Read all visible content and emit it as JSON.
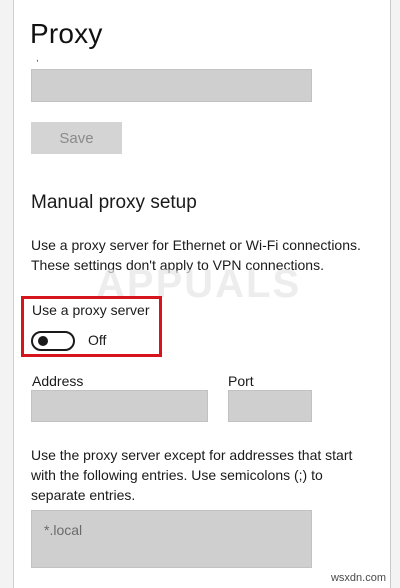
{
  "page": {
    "title": "Proxy"
  },
  "top_section": {
    "save_label": "Save"
  },
  "manual_proxy": {
    "heading": "Manual proxy setup",
    "description_line1": "Use a proxy server for Ethernet or Wi-Fi connections.",
    "description_line2": "These settings don't apply to VPN connections.",
    "use_proxy_label": "Use a proxy server",
    "toggle_state": "Off",
    "address_label": "Address",
    "address_value": "",
    "port_label": "Port",
    "port_value": "",
    "exceptions_line1": "Use the proxy server except for addresses that start",
    "exceptions_line2": "with the following entries. Use semicolons (;) to",
    "exceptions_line3": "separate entries.",
    "exceptions_value": "*.local"
  },
  "watermark": "APPUALS",
  "site_mark": "wsxdn.com",
  "colors": {
    "highlight": "#d6141c",
    "field_bg": "#cfcfcf"
  }
}
